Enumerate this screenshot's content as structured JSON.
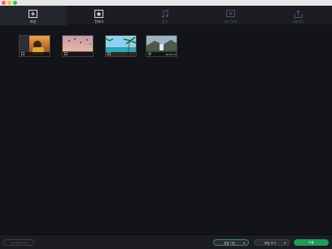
{
  "window": {
    "controls": [
      "close",
      "minimize",
      "zoom"
    ]
  },
  "tabs": [
    {
      "label": "파일",
      "icon": "add-file-icon",
      "active": true
    },
    {
      "label": "컨버터",
      "icon": "star-doc-icon",
      "active": true
    },
    {
      "label": "음악",
      "icon": "music-note-icon",
      "active": false
    },
    {
      "label": "미리 보기",
      "icon": "preview-icon",
      "active": false
    },
    {
      "label": "내보내기",
      "icon": "export-icon",
      "active": false
    }
  ],
  "media": [
    {
      "kind": "photo",
      "scene": "person-sunset",
      "duration": ""
    },
    {
      "kind": "photo",
      "scene": "balloons-sky",
      "duration": ""
    },
    {
      "kind": "photo",
      "scene": "palm-beach",
      "duration": ""
    },
    {
      "kind": "video",
      "scene": "waterfall-landscape",
      "duration": "00:00:05"
    }
  ],
  "bottom": {
    "remove_all": "선택 항목 제거",
    "sort_dropdown": "정렬 기준",
    "size_dropdown": "파일 추가",
    "next_button": "다음"
  },
  "colors": {
    "accent": "#1f9c57",
    "background": "#121418",
    "toolbar": "#1b1d23"
  }
}
